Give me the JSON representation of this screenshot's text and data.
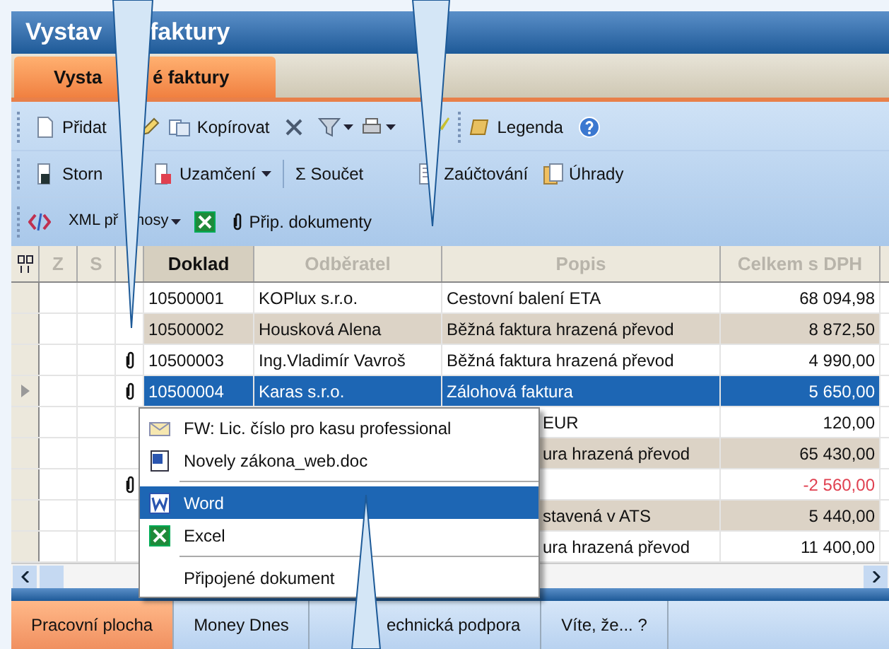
{
  "window": {
    "title_parts": [
      "Vystav",
      "faktury"
    ]
  },
  "tabs": [
    {
      "label_parts": [
        "Vysta",
        "é faktury"
      ],
      "selected": true
    }
  ],
  "toolbars": [
    {
      "labels": [
        "Přidat",
        "Kopírovat",
        "Legenda"
      ]
    },
    {
      "labels": [
        "Storn",
        "Uzamčení",
        "Σ Součet",
        "Zaúčtování",
        "Úhrady"
      ]
    },
    {
      "labels": [
        "XML př",
        "nosy",
        "Přip. dokumenty"
      ]
    }
  ],
  "grid": {
    "columns": [
      {
        "label": "Z",
        "selected": false
      },
      {
        "label": "S",
        "selected": false
      },
      {
        "label": "Doklad",
        "selected": true
      },
      {
        "label": "Odběratel",
        "selected": false
      },
      {
        "label": "Popis",
        "selected": false
      },
      {
        "label": "Celkem s DPH",
        "selected": false
      }
    ],
    "rows": [
      {
        "doklad": "10500001",
        "odberatel": "KOPlux s.r.o.",
        "popis": "Cestovní balení ETA",
        "celkem": "68 094,98",
        "attachment": false,
        "selected": false,
        "negative": false
      },
      {
        "doklad": "10500002",
        "odberatel": "Housková  Alena",
        "popis": "Běžná faktura hrazená převod",
        "celkem": "8 872,50",
        "attachment": false,
        "selected": false,
        "negative": false
      },
      {
        "doklad": "10500003",
        "odberatel": "Ing.Vladimír Vavroš",
        "popis": "Běžná faktura hrazená převod",
        "celkem": "4 990,00",
        "attachment": true,
        "selected": false,
        "negative": false
      },
      {
        "doklad": "10500004",
        "odberatel": "Karas s.r.o.",
        "popis": "Zálohová faktura",
        "celkem": "5 650,00",
        "attachment": true,
        "selected": true,
        "negative": false
      },
      {
        "popis": "EUR",
        "celkem": "120,00",
        "attachment": false,
        "selected": false,
        "negative": false
      },
      {
        "popis": "ura hrazená převod",
        "celkem": "65 430,00",
        "attachment": false,
        "selected": false,
        "negative": false
      },
      {
        "celkem": "-2 560,00",
        "attachment": true,
        "selected": false,
        "negative": true
      },
      {
        "popis": "stavená v ATS",
        "celkem": "5 440,00",
        "attachment": false,
        "selected": false,
        "negative": false
      },
      {
        "popis": "ura hrazená převod",
        "celkem": "11 400,00",
        "attachment": false,
        "selected": false,
        "negative": false
      }
    ]
  },
  "menu": {
    "items": [
      {
        "kind": "item",
        "label": "FW: Lic. číslo pro kasu professional",
        "selected": false
      },
      {
        "kind": "item",
        "label": "Novely zákona_web.doc",
        "selected": false
      },
      {
        "kind": "separator"
      },
      {
        "kind": "item",
        "label": "Word",
        "selected": true
      },
      {
        "kind": "item",
        "label": "Excel",
        "selected": false
      },
      {
        "kind": "separator"
      },
      {
        "kind": "item",
        "label": "Připojené dokument",
        "selected": false
      }
    ]
  },
  "bottom_tabs": [
    {
      "label": "Pracovní plocha",
      "selected": true
    },
    {
      "label": "Money Dnes",
      "selected": false
    },
    {
      "label": "echnická podpora",
      "selected": false
    },
    {
      "label": "Víte, že... ?",
      "selected": false
    }
  ]
}
